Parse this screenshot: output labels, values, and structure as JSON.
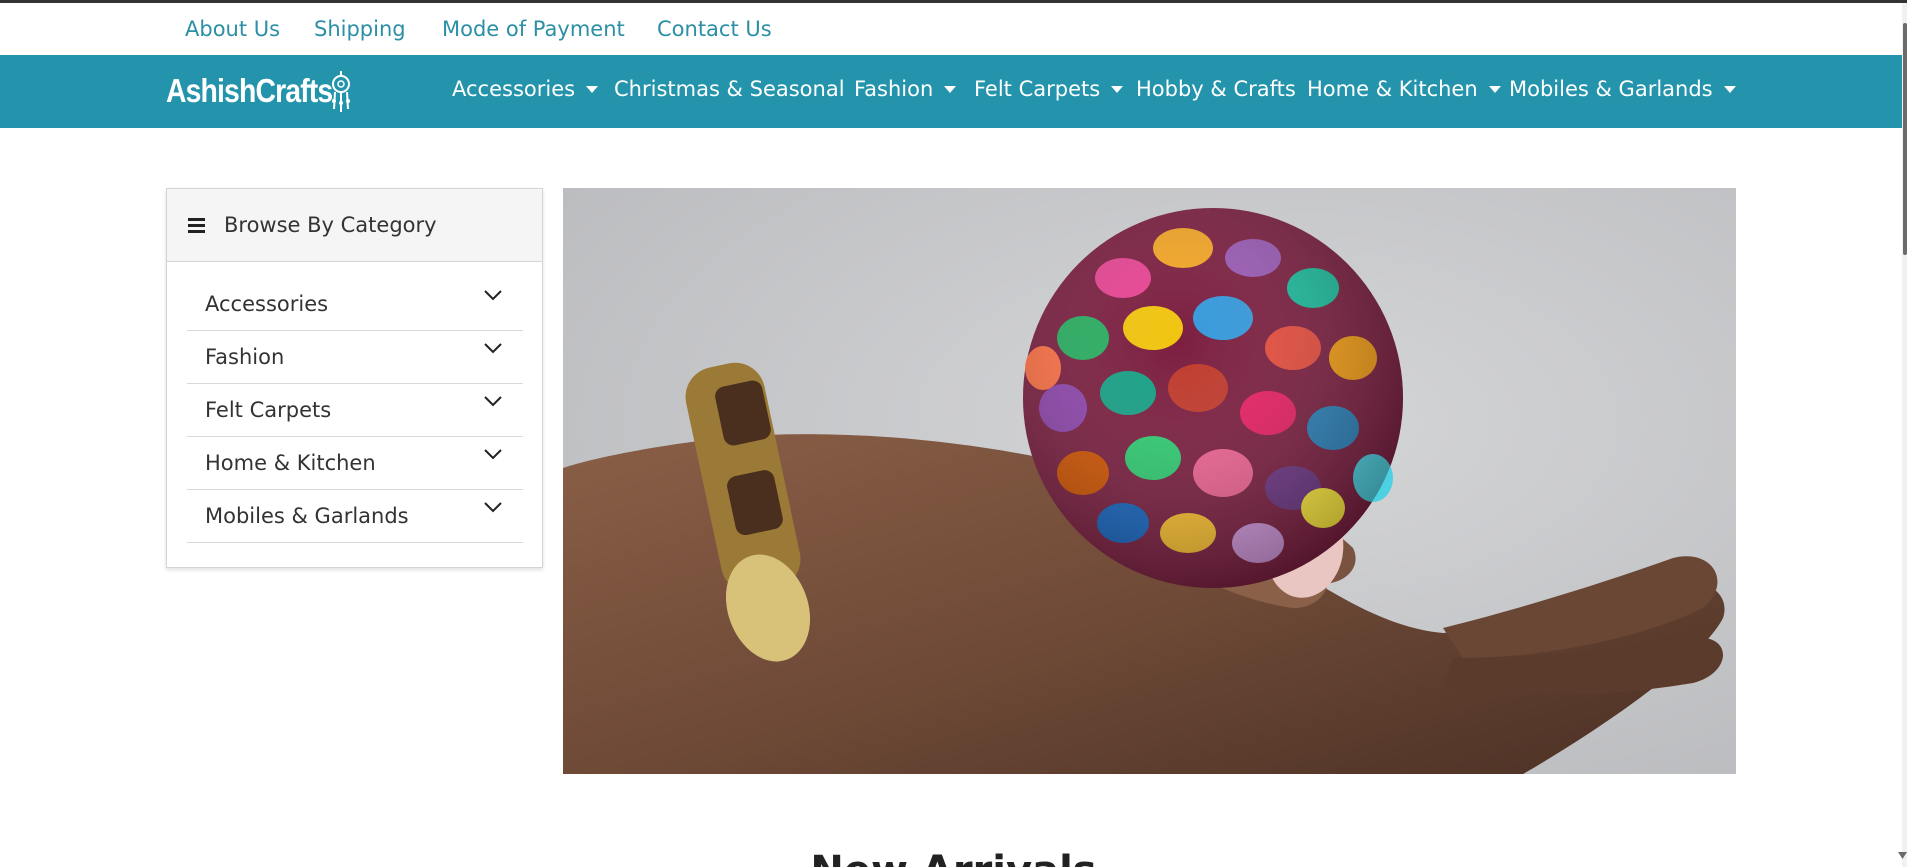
{
  "utility_links": [
    {
      "label": "About Us"
    },
    {
      "label": "Shipping"
    },
    {
      "label": "Mode of Payment"
    },
    {
      "label": "Contact Us"
    }
  ],
  "brand": {
    "name": "AshishCrafts"
  },
  "nav": {
    "items": [
      {
        "label": "Accessories",
        "dropdown": true
      },
      {
        "label": "Christmas & Seasonal",
        "dropdown": false
      },
      {
        "label": "Fashion",
        "dropdown": true
      },
      {
        "label": "Felt Carpets",
        "dropdown": true
      },
      {
        "label": "Hobby & Crafts",
        "dropdown": false
      },
      {
        "label": "Home & Kitchen",
        "dropdown": true
      },
      {
        "label": "Mobiles & Garlands",
        "dropdown": true
      }
    ]
  },
  "sidebar": {
    "title": "Browse By Category",
    "icon": "hamburger-menu-icon",
    "categories": [
      {
        "label": "Accessories"
      },
      {
        "label": "Fashion"
      },
      {
        "label": "Felt Carpets"
      },
      {
        "label": "Home & Kitchen"
      },
      {
        "label": "Mobiles & Garlands"
      }
    ]
  },
  "hero": {
    "image": "hand holding a colorful felt ball"
  },
  "section": {
    "title": "New Arrivals"
  },
  "colors": {
    "brand": "#2394ab",
    "link": "#2b8fa5",
    "text": "#333333"
  }
}
